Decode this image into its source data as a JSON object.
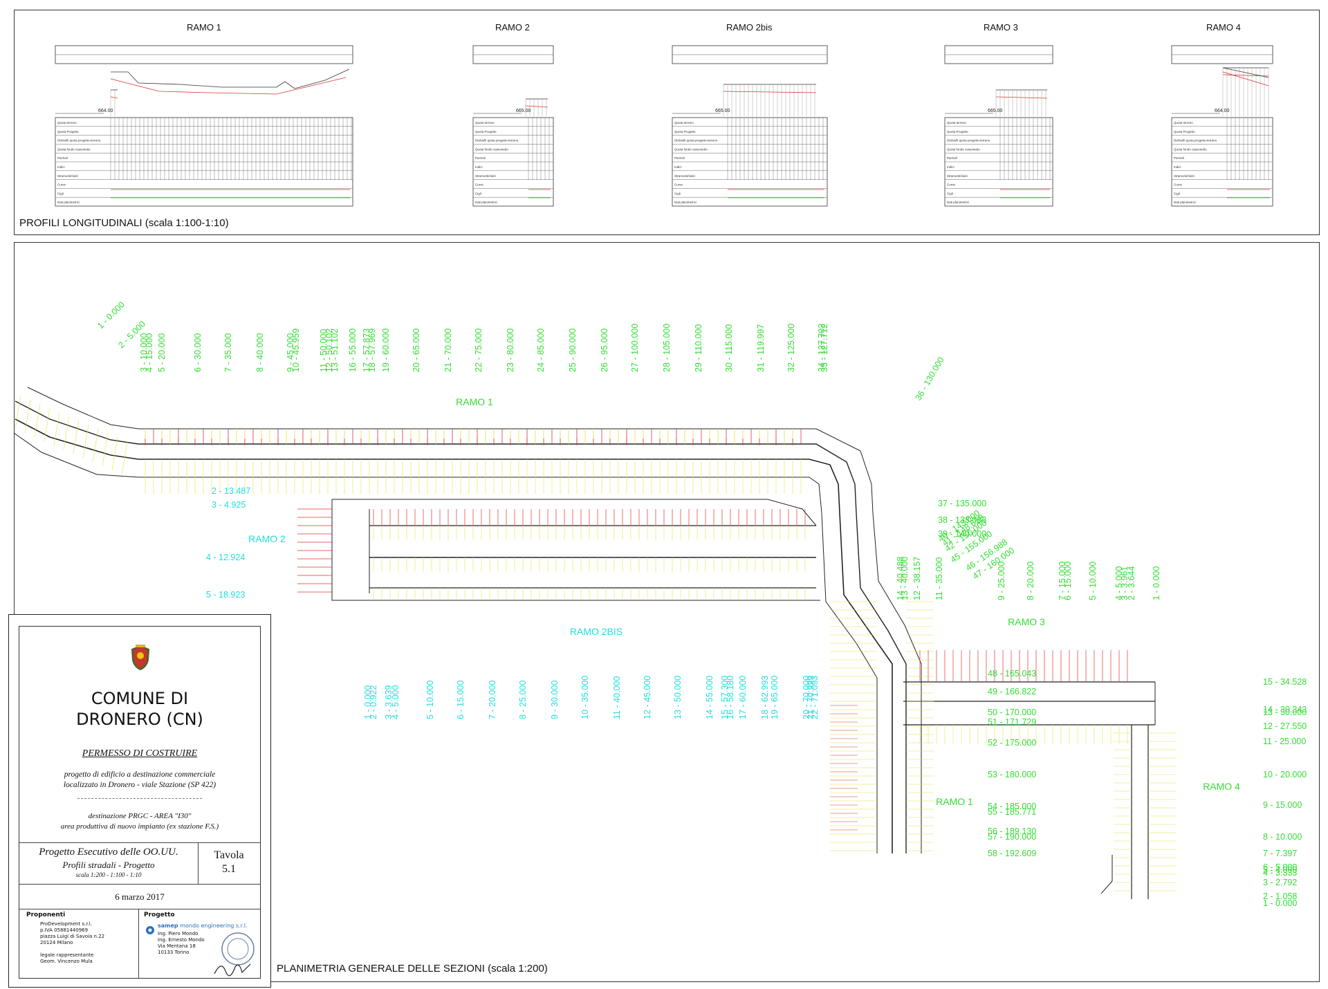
{
  "profiles": {
    "titles": [
      "RAMO 1",
      "RAMO 2",
      "RAMO 2bis",
      "RAMO 3",
      "RAMO 4"
    ],
    "section_label": "PROFILI LONGITUDINALI (scala 1:100-1:10)",
    "elevations": [
      "664.00",
      "665.00",
      "665.00",
      "665.00",
      "664.00"
    ],
    "row_labels": [
      "Quota terreno",
      "Quota Progetto",
      "Dislivelli quota progetto-terreno",
      "Quota fondo cassonetto",
      "Parziali",
      "Indici",
      "Stramonti/rialzi",
      "Curve",
      "Cigli",
      "Dati planimetrici"
    ]
  },
  "plan": {
    "section_label": "PLANIMETRIA GENERALE DELLE SEZIONI (scala 1:200)",
    "ramo_labels": {
      "ramo1_top": "RAMO 1",
      "ramo2": "RAMO 2",
      "ramo2bis": "RAMO 2BIS",
      "ramo3": "RAMO 3",
      "ramo1_bottom": "RAMO 1",
      "ramo4": "RAMO 4"
    },
    "ramo1_stations": [
      "1 - 0.000",
      "2 - 5.000",
      "3 - 10.000",
      "4 - 15.000",
      "5 - 20.000",
      "6 - 30.000",
      "7 - 35.000",
      "8 - 40.000",
      "9 - 45.000",
      "10 - 45.959",
      "11 - 50.000",
      "12 - 50.102",
      "13 - 51.102",
      "16 - 55.000",
      "17 - 57.873",
      "18 - 57.969",
      "19 - 60.000",
      "20 - 65.000",
      "21 - 70.000",
      "22 - 75.000",
      "23 - 80.000",
      "24 - 85.000",
      "25 - 90.000",
      "26 - 95.000",
      "27 - 100.000",
      "28 - 105.000",
      "29 - 110.000",
      "30 - 115.000",
      "31 - 119.997",
      "32 - 125.000",
      "34 - 127.702",
      "35 - 127.712",
      "36 - 130.000"
    ],
    "ramo1_lower": [
      "37 - 135.000",
      "38 - 138.083",
      "39 - 140.000",
      "40 - 143.000",
      "41 - 148.659",
      "42 - 150.000",
      "45 - 155.000",
      "46 - 156.988",
      "47 - 160.000",
      "48 - 165.043",
      "49 - 166.822",
      "50 - 170.000",
      "51 - 171.729",
      "52 - 175.000",
      "53 - 180.000",
      "54 - 185.000",
      "55 - 185.771",
      "56 - 189.130",
      "57 - 190.000",
      "58 - 192.609"
    ],
    "ramo2_stations": [
      "2 - 13.487",
      "3 - 4.925",
      "4 - 12.924",
      "5 - 18.923"
    ],
    "ramo2bis_stations": [
      "1 - 0.000",
      "2 - 0.922",
      "3 - 3.639",
      "4 - 5.000",
      "5 - 10.000",
      "6 - 15.000",
      "7 - 20.000",
      "8 - 25.000",
      "9 - 30.000",
      "10 - 35.000",
      "11 - 40.000",
      "12 - 45.000",
      "13 - 50.000",
      "14 - 55.000",
      "15 - 57.300",
      "16 - 58.180",
      "17 - 60.000",
      "18 - 62.993",
      "19 - 65.000",
      "20 - 70.000",
      "21 - 70.999",
      "22 - 71.093"
    ],
    "ramo3_stations": [
      "1 - 0.000",
      "2 - 3.644",
      "3 - 3.961",
      "4 - 5.000",
      "5 - 10.000",
      "6 - 15.000",
      "7 - 15.000",
      "8 - 20.000",
      "9 - 25.000",
      "11 - 35.000",
      "12 - 38.157",
      "13 - 40.000",
      "14 - 40.488"
    ],
    "ramo4_stations": [
      "15 - 34.528",
      "14 - 30.343",
      "13 - 30.000",
      "12 - 27.550",
      "11 - 25.000",
      "10 - 20.000",
      "9 - 15.000",
      "8 - 10.000",
      "7 - 7.397",
      "6 - 5.000",
      "5 - 4.090",
      "4 - 3.333",
      "3 - 2.792",
      "2 - 1.058",
      "1 - 0.000"
    ]
  },
  "title_block": {
    "comune_line1": "COMUNE DI",
    "comune_line2": "DRONERO (CN)",
    "permesso": "PERMESSO DI COSTRUIRE",
    "descr1": "progetto di edificio a destinazione commerciale",
    "descr2": "localizzato in Dronero - viale Stazione (SP 422)",
    "dest1": "destinazione PRGC - AREA \"I30\"",
    "dest2": "area produttiva di nuovo impianto (ex stazione F.S.)",
    "progetto_title": "Progetto Esecutivo delle OO.UU.",
    "progetto_sub": "Profili stradali - Progetto",
    "progetto_scale": "scala 1:200 - 1:100 - 1:10",
    "tavola_label": "Tavola",
    "tavola_num": "5.1",
    "date": "6 marzo 2017",
    "proponenti_head": "Proponenti",
    "proponenti_lines": [
      "ProDevelopment s.r.l.",
      "p.IVA 05881440969",
      "piazza Luigi di Savoia n.22",
      "20124 Milano",
      "",
      "legale rappresentante",
      "Geom. Vincenzo Mula"
    ],
    "progetto_head": "Progetto",
    "samep_brand": "samep",
    "samep_rest": "mondo engineering s.r.l.",
    "progetto_lines": [
      "Ing. Piero Mondo",
      "Ing. Ernesto Mondo",
      "Via Mentana 18",
      "10133 Torino"
    ]
  }
}
